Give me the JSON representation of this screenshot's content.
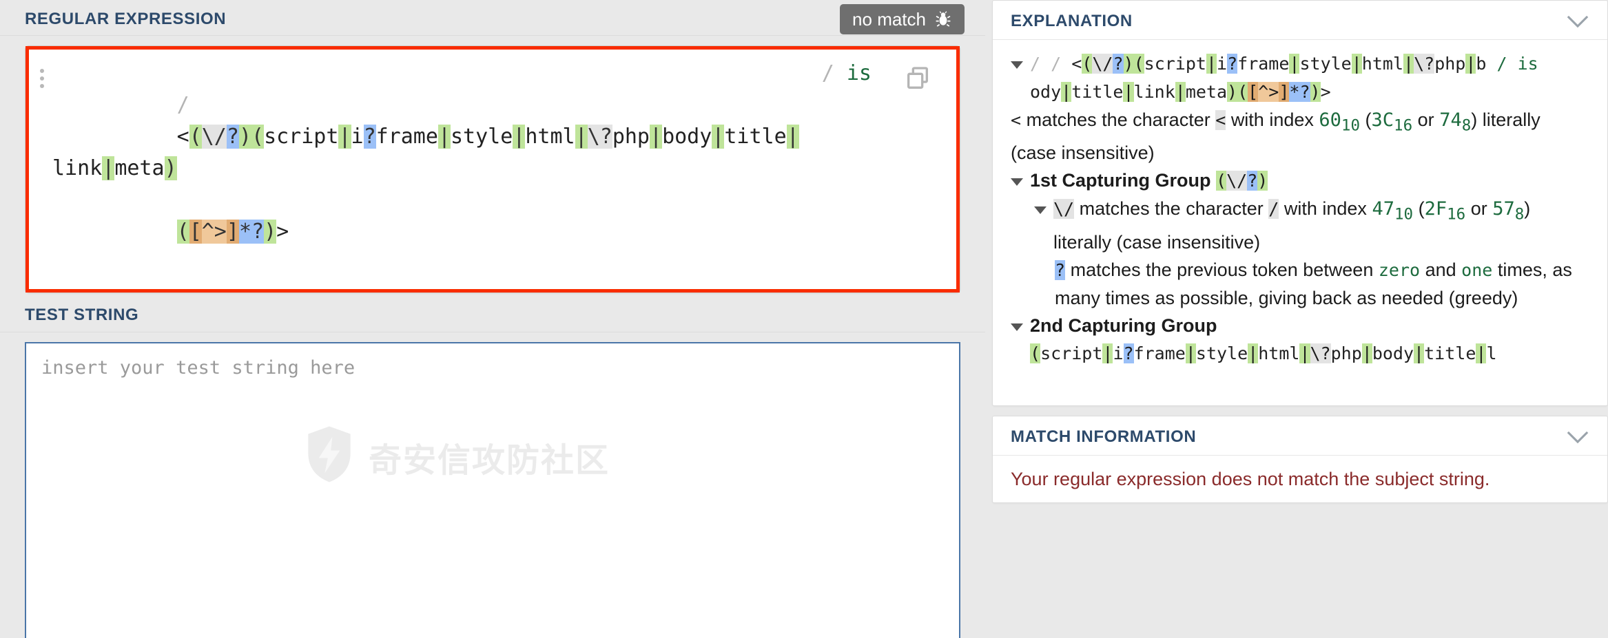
{
  "left": {
    "regex_section": {
      "title": "REGULAR EXPRESSION",
      "status_badge": {
        "label": "no match",
        "icon": "bug-icon",
        "bg": "#6f6f6f",
        "fg": "#ffffff"
      },
      "delimiter": "/",
      "flags": "is",
      "pattern": "<(\\/?)(script|i?frame|style|html|\\?php|body|title|link|meta)([^>]*?)>",
      "copy_icon": "copy-icon",
      "drag_handle": "drag-handle",
      "error_outline_color": "#f92c00",
      "tokens_line1": [
        {
          "t": "<",
          "c": "plain"
        },
        {
          "t": "(",
          "c": "gp"
        },
        {
          "t": "\\/",
          "c": "esc"
        },
        {
          "t": "?",
          "c": "qnt"
        },
        {
          "t": ")",
          "c": "gp"
        },
        {
          "t": "(",
          "c": "gp"
        },
        {
          "t": "script",
          "c": "plain"
        },
        {
          "t": "|",
          "c": "alt"
        },
        {
          "t": "i",
          "c": "plain"
        },
        {
          "t": "?",
          "c": "qnt"
        },
        {
          "t": "frame",
          "c": "plain"
        },
        {
          "t": "|",
          "c": "alt"
        },
        {
          "t": "style",
          "c": "plain"
        },
        {
          "t": "|",
          "c": "alt"
        },
        {
          "t": "html",
          "c": "plain"
        },
        {
          "t": "|",
          "c": "alt"
        },
        {
          "t": "\\?",
          "c": "esc"
        },
        {
          "t": "php",
          "c": "plain"
        },
        {
          "t": "|",
          "c": "alt"
        },
        {
          "t": "body",
          "c": "plain"
        },
        {
          "t": "|",
          "c": "alt"
        },
        {
          "t": "title",
          "c": "plain"
        },
        {
          "t": "|",
          "c": "alt"
        },
        {
          "t": "link",
          "c": "plain"
        },
        {
          "t": "|",
          "c": "alt"
        },
        {
          "t": "meta",
          "c": "plain"
        },
        {
          "t": ")",
          "c": "gp"
        }
      ],
      "tokens_line2": [
        {
          "t": "(",
          "c": "gp"
        },
        {
          "t": "[",
          "c": "cls"
        },
        {
          "t": "^>",
          "c": "clsin"
        },
        {
          "t": "]",
          "c": "cls"
        },
        {
          "t": "*?",
          "c": "qnt"
        },
        {
          "t": ")",
          "c": "gp"
        },
        {
          "t": ">",
          "c": "plain"
        }
      ]
    },
    "test_section": {
      "title": "TEST STRING",
      "placeholder": "insert your test string here",
      "value": ""
    },
    "watermark": {
      "text": "奇安信攻防社区",
      "icon": "shield-bolt-icon"
    }
  },
  "right": {
    "explanation": {
      "title": "EXPLANATION",
      "collapse_icon": "chevron-down-icon",
      "header_line1": [
        {
          "t": "/ ",
          "c": "slash"
        },
        {
          "t": "<",
          "c": "plain"
        },
        {
          "t": "(",
          "c": "gp"
        },
        {
          "t": "\\/",
          "c": "esc"
        },
        {
          "t": "?",
          "c": "qnt"
        },
        {
          "t": ")",
          "c": "gp"
        },
        {
          "t": "(",
          "c": "gp"
        },
        {
          "t": "script",
          "c": "plain"
        },
        {
          "t": "|",
          "c": "alt"
        },
        {
          "t": "i",
          "c": "plain"
        },
        {
          "t": "?",
          "c": "qnt"
        },
        {
          "t": "frame",
          "c": "plain"
        },
        {
          "t": "|",
          "c": "alt"
        },
        {
          "t": "style",
          "c": "plain"
        },
        {
          "t": "|",
          "c": "alt"
        },
        {
          "t": "html",
          "c": "plain"
        },
        {
          "t": "|",
          "c": "alt"
        },
        {
          "t": "\\?",
          "c": "esc"
        },
        {
          "t": "php",
          "c": "plain"
        },
        {
          "t": "|",
          "c": "alt"
        },
        {
          "t": "b",
          "c": "plain"
        }
      ],
      "header_flags": "/ is",
      "header_line2": [
        {
          "t": "ody",
          "c": "plain"
        },
        {
          "t": "|",
          "c": "alt"
        },
        {
          "t": "title",
          "c": "plain"
        },
        {
          "t": "|",
          "c": "alt"
        },
        {
          "t": "link",
          "c": "plain"
        },
        {
          "t": "|",
          "c": "alt"
        },
        {
          "t": "meta",
          "c": "plain"
        },
        {
          "t": ")",
          "c": "gp"
        },
        {
          "t": "(",
          "c": "gp"
        },
        {
          "t": "[",
          "c": "cls"
        },
        {
          "t": "^>",
          "c": "clsin"
        },
        {
          "t": "]",
          "c": "cls"
        },
        {
          "t": "*?",
          "c": "qnt"
        },
        {
          "t": ")",
          "c": "gp"
        },
        {
          "t": ">",
          "c": "plain"
        }
      ],
      "item1": {
        "token": "<",
        "text_a": "matches the character",
        "char": "<",
        "text_b": "with index",
        "dec": "60",
        "dec_sub": "10",
        "open": "(",
        "hex": "3C",
        "hex_sub": "16",
        "or": "or",
        "oct": "74",
        "oct_sub": "8",
        "close": ")",
        "text_c": "literally (case insensitive)"
      },
      "group1": {
        "label": "1st Capturing Group",
        "tokens": [
          {
            "t": "(",
            "c": "gp"
          },
          {
            "t": "\\/",
            "c": "esc"
          },
          {
            "t": "?",
            "c": "qnt"
          },
          {
            "t": ")",
            "c": "gp"
          }
        ],
        "child1": {
          "token": "\\/",
          "text_a": "matches the character",
          "char": "/",
          "text_b": "with index",
          "dec": "47",
          "dec_sub": "10",
          "open": "(",
          "hex": "2F",
          "hex_sub": "16",
          "or": "or",
          "oct": "57",
          "oct_sub": "8",
          "close": ")",
          "text_c": "literally (case insensitive)"
        },
        "child2": {
          "token": "?",
          "text_a": "matches the previous token between",
          "kw1": "zero",
          "and": "and",
          "kw2": "one",
          "text_b": "times, as many times as possible, giving back as needed (greedy)"
        }
      },
      "group2": {
        "label": "2nd Capturing Group",
        "tokens": [
          {
            "t": "(",
            "c": "gp"
          },
          {
            "t": "script",
            "c": "plain"
          },
          {
            "t": "|",
            "c": "alt"
          },
          {
            "t": "i",
            "c": "plain"
          },
          {
            "t": "?",
            "c": "qnt"
          },
          {
            "t": "frame",
            "c": "plain"
          },
          {
            "t": "|",
            "c": "alt"
          },
          {
            "t": "style",
            "c": "plain"
          },
          {
            "t": "|",
            "c": "alt"
          },
          {
            "t": "html",
            "c": "plain"
          },
          {
            "t": "|",
            "c": "alt"
          },
          {
            "t": "\\?",
            "c": "esc"
          },
          {
            "t": "php",
            "c": "plain"
          },
          {
            "t": "|",
            "c": "alt"
          },
          {
            "t": "body",
            "c": "plain"
          },
          {
            "t": "|",
            "c": "alt"
          },
          {
            "t": "title",
            "c": "plain"
          },
          {
            "t": "|",
            "c": "alt"
          },
          {
            "t": "l",
            "c": "plain"
          }
        ]
      }
    },
    "match_information": {
      "title": "MATCH INFORMATION",
      "collapse_icon": "chevron-down-icon",
      "body": "Your regular expression does not match the subject string."
    }
  }
}
